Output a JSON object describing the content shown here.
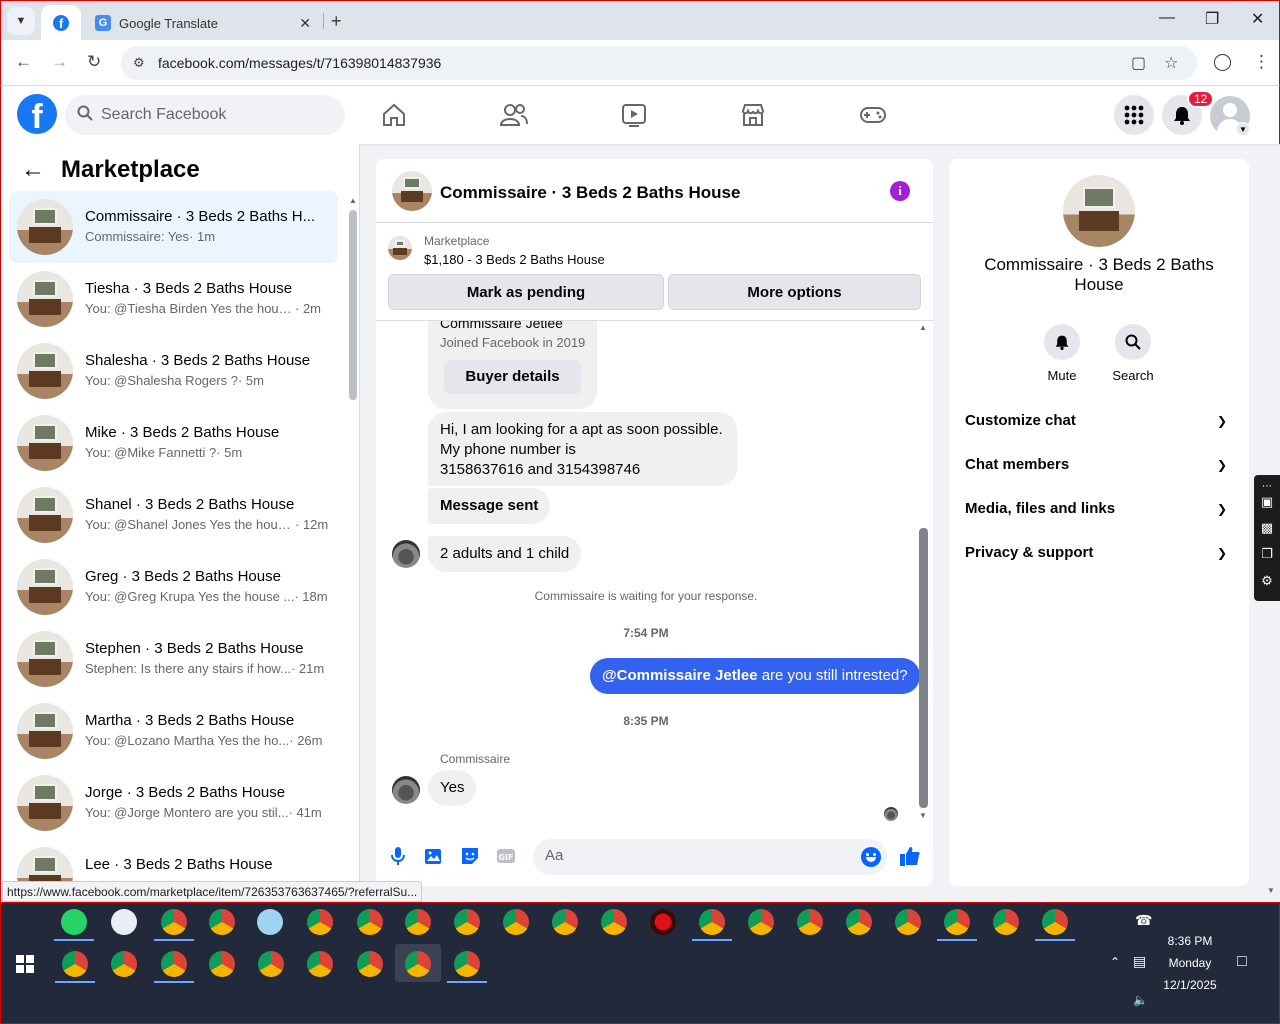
{
  "browser": {
    "tabs": [
      {
        "label": ""
      },
      {
        "label": "Google Translate"
      }
    ],
    "url": "facebook.com/messages/t/716398014837936",
    "status_url": "https://www.facebook.com/marketplace/item/726353763637465/?referralSu..."
  },
  "fb_header": {
    "search_placeholder": "Search Facebook",
    "notification_count": "12"
  },
  "sidebar": {
    "title": "Marketplace",
    "conversations": [
      {
        "title": "Commissaire · 3 Beds 2 Baths H...",
        "preview": "Commissaire: Yes",
        "time": "· 1m",
        "selected": true
      },
      {
        "title": "Tiesha · 3 Beds 2 Baths House",
        "preview": "You: @Tiesha Birden Yes the house...",
        "time": "· 2m"
      },
      {
        "title": "Shalesha · 3 Beds 2 Baths House",
        "preview": "You: @Shalesha Rogers ?",
        "time": "· 5m"
      },
      {
        "title": "Mike · 3 Beds 2 Baths House",
        "preview": "You: @Mike Fannetti ?",
        "time": "· 5m"
      },
      {
        "title": "Shanel · 3 Beds 2 Baths House",
        "preview": "You: @Shanel Jones Yes the hous...",
        "time": "· 12m"
      },
      {
        "title": "Greg · 3 Beds 2 Baths House",
        "preview": "You: @Greg Krupa Yes the house ...",
        "time": "· 18m"
      },
      {
        "title": "Stephen · 3 Beds 2 Baths House",
        "preview": "Stephen: Is there any stairs if how...",
        "time": "· 21m"
      },
      {
        "title": "Martha · 3 Beds 2 Baths House",
        "preview": "You: @Lozano Martha Yes the ho...",
        "time": "· 26m"
      },
      {
        "title": "Jorge · 3 Beds 2 Baths House",
        "preview": "You: @Jorge Montero are you stil...",
        "time": "· 41m"
      },
      {
        "title": "Lee · 3 Beds 2 Baths House",
        "preview": "",
        "time": ""
      }
    ]
  },
  "chat": {
    "title": "Commissaire · 3 Beds 2 Baths House",
    "listing_source": "Marketplace",
    "listing_detail": "$1,180 - 3 Beds 2 Baths House",
    "mark_pending_label": "Mark as pending",
    "more_options_label": "More options",
    "buyer_name": "Commissaire Jetlee",
    "buyer_joined": "Joined Facebook in 2019",
    "buyer_details_label": "Buyer details",
    "msg_apt": [
      "Hi, I am looking for a apt as soon possible.",
      "My phone number is",
      "3158637616 and 3154398746"
    ],
    "msg_sent": "Message sent",
    "msg_family": "2 adults and 1 child",
    "waiting_notice": "Commissaire is waiting for your response.",
    "time_1": "7:54 PM",
    "out_mention": "@Commissaire Jetlee",
    "out_text": " are you still intrested?",
    "time_2": "8:35 PM",
    "sender_name": "Commissaire",
    "msg_yes": "Yes",
    "composer_placeholder": "Aa"
  },
  "details": {
    "name": "Commissaire · 3 Beds 2 Baths House",
    "mute_label": "Mute",
    "search_label": "Search",
    "sections": [
      "Customize chat",
      "Chat members",
      "Media, files and links",
      "Privacy & support"
    ]
  },
  "taskbar": {
    "time": "8:36 PM",
    "day": "Monday",
    "date": "12/1/2025"
  },
  "colors": {
    "fb_blue": "#1877f2",
    "outgoing_bubble": "#3462f0",
    "info_purple": "#a21fd6",
    "badge_red": "#e41e3f",
    "taskbar_bg": "#22293a"
  }
}
